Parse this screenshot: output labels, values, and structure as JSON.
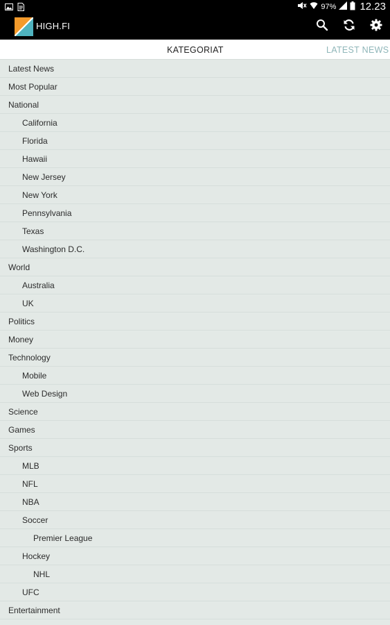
{
  "status_bar": {
    "battery": "97%",
    "time": "12.23",
    "icons": [
      "image-icon",
      "document-icon",
      "mute-icon",
      "wifi-icon",
      "signal-icon",
      "battery-icon"
    ]
  },
  "app": {
    "title": "HIGH.FI",
    "actions": [
      "search-icon",
      "refresh-icon",
      "settings-icon"
    ]
  },
  "tabs": {
    "active": "KATEGORIAT",
    "next": "LATEST NEWS"
  },
  "categories": [
    {
      "label": "Latest News",
      "level": 0
    },
    {
      "label": "Most Popular",
      "level": 0
    },
    {
      "label": "National",
      "level": 0
    },
    {
      "label": "California",
      "level": 1
    },
    {
      "label": "Florida",
      "level": 1
    },
    {
      "label": "Hawaii",
      "level": 1
    },
    {
      "label": "New Jersey",
      "level": 1
    },
    {
      "label": "New York",
      "level": 1
    },
    {
      "label": "Pennsylvania",
      "level": 1
    },
    {
      "label": "Texas",
      "level": 1
    },
    {
      "label": "Washington D.C.",
      "level": 1
    },
    {
      "label": "World",
      "level": 0
    },
    {
      "label": "Australia",
      "level": 1
    },
    {
      "label": "UK",
      "level": 1
    },
    {
      "label": "Politics",
      "level": 0
    },
    {
      "label": "Money",
      "level": 0
    },
    {
      "label": "Technology",
      "level": 0
    },
    {
      "label": "Mobile",
      "level": 1
    },
    {
      "label": "Web Design",
      "level": 1
    },
    {
      "label": "Science",
      "level": 0
    },
    {
      "label": "Games",
      "level": 0
    },
    {
      "label": "Sports",
      "level": 0
    },
    {
      "label": "MLB",
      "level": 1
    },
    {
      "label": "NFL",
      "level": 1
    },
    {
      "label": "NBA",
      "level": 1
    },
    {
      "label": "Soccer",
      "level": 1
    },
    {
      "label": "Premier League",
      "level": 2
    },
    {
      "label": "Hockey",
      "level": 1
    },
    {
      "label": "NHL",
      "level": 2
    },
    {
      "label": "UFC",
      "level": 1
    },
    {
      "label": "Entertainment",
      "level": 0
    }
  ],
  "colors": {
    "bar_background": "#000000",
    "list_background": "#e3e9e6",
    "tab_inactive": "#8fb6b9",
    "logo_orange": "#f39a2b",
    "logo_teal": "#4fb3bf"
  }
}
